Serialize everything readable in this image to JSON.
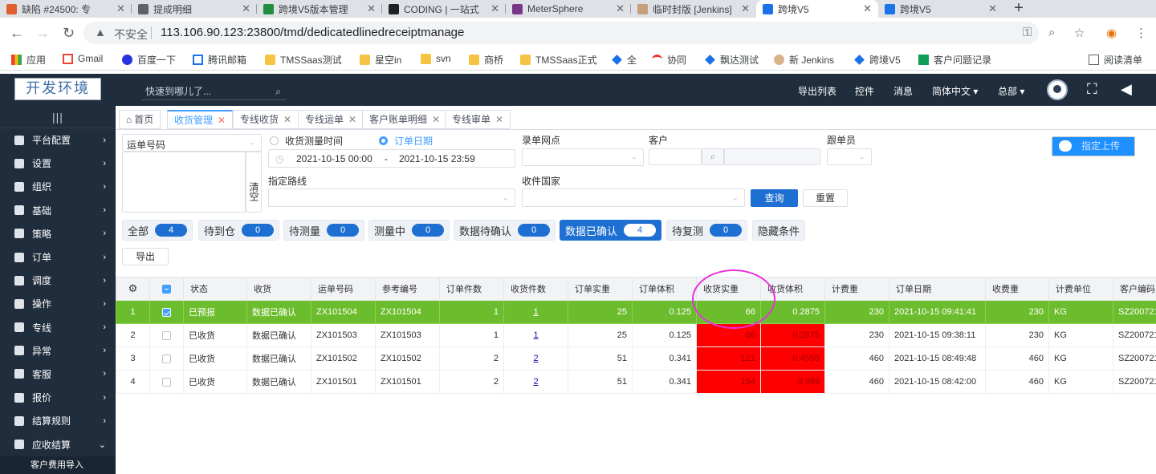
{
  "browser": {
    "tabs": [
      {
        "label": "缺陷 #24500: 专",
        "color": "#e06030"
      },
      {
        "label": "提成明细",
        "color": "#5f6368"
      },
      {
        "label": "跨境V5版本管理",
        "color": "#1e8e3e"
      },
      {
        "label": "CODING | 一站式",
        "color": "#202124"
      },
      {
        "label": "MeterSphere",
        "color": "#783887"
      },
      {
        "label": "临时封版 [Jenkins]",
        "color": "#c5a07a"
      },
      {
        "label": "跨境V5",
        "color": "#1a73e8"
      },
      {
        "label": "跨境V5",
        "color": "#1a73e8"
      }
    ],
    "new_tab": "+",
    "back": "←",
    "forward": "→",
    "reload": "↻",
    "warn_icon": "▲",
    "insecure_label": "不安全",
    "url": "113.106.90.123:23800/tmd/dedicatedlinedreceiptmanage",
    "right_icons": [
      "⚿",
      "⌕",
      "☆",
      "◉",
      "⋮"
    ],
    "bookmarks": [
      {
        "label": "应用",
        "icon": "apps"
      },
      {
        "label": "Gmail",
        "icon": "gmail"
      },
      {
        "label": "百度一下",
        "icon": "baidu"
      },
      {
        "label": "腾讯邮箱",
        "icon": "mail"
      },
      {
        "label": "TMSSaas测试",
        "icon": "folder"
      },
      {
        "label": "星空in",
        "icon": "folder"
      },
      {
        "label": "svn",
        "icon": "folder"
      },
      {
        "label": "商桥",
        "icon": "folder"
      },
      {
        "label": "TMSSaas正式",
        "icon": "folder"
      },
      {
        "label": "全",
        "icon": "app"
      },
      {
        "label": "协同",
        "icon": "app"
      },
      {
        "label": "飘达测试",
        "icon": "app"
      },
      {
        "label": "新 Jenkins",
        "icon": "jenkins"
      },
      {
        "label": "跨境V5",
        "icon": "app"
      },
      {
        "label": "客户问题记录",
        "icon": "sheet"
      }
    ],
    "reading_list": "阅读清单"
  },
  "header": {
    "logo": "开发环境",
    "search_placeholder": "快速到哪儿了...",
    "search_icon": "⌕",
    "links": [
      "导出列表",
      "控件",
      "消息",
      "简体中文 ▾",
      "总部 ▾"
    ],
    "fullscreen_icon": "⛶",
    "collapse_icon": "◀"
  },
  "sidebar": {
    "toggle": "|||",
    "items": [
      {
        "label": "平台配置",
        "chev": "›"
      },
      {
        "label": "设置",
        "chev": "›"
      },
      {
        "label": "组织",
        "chev": "›"
      },
      {
        "label": "基础",
        "chev": "›"
      },
      {
        "label": "策略",
        "chev": "›"
      },
      {
        "label": "订单",
        "chev": "›"
      },
      {
        "label": "调度",
        "chev": "›"
      },
      {
        "label": "操作",
        "chev": "›"
      },
      {
        "label": "专线",
        "chev": "›"
      },
      {
        "label": "异常",
        "chev": "›"
      },
      {
        "label": "客服",
        "chev": "›"
      },
      {
        "label": "报价",
        "chev": "›"
      },
      {
        "label": "结算规则",
        "chev": "›"
      },
      {
        "label": "应收结算",
        "chev": "⌄"
      }
    ],
    "sub_item": "客户费用导入"
  },
  "page_tabs": [
    {
      "label": "首页",
      "close": ""
    },
    {
      "label": "收货管理",
      "close": "✕"
    },
    {
      "label": "专线收货",
      "close": "✕"
    },
    {
      "label": "专线运单",
      "close": "✕"
    },
    {
      "label": "客户账单明细",
      "close": "✕"
    },
    {
      "label": "专线审单",
      "close": "✕"
    }
  ],
  "filters": {
    "waybill_select": "运单号码",
    "clear_label": "清空",
    "radio_measure": "收货测量时间",
    "radio_order": "订单日期",
    "date_start": "2021-10-15 00:00",
    "date_sep": "-",
    "date_end": "2021-10-15 23:59",
    "route_label": "指定路线",
    "branch_label": "录单网点",
    "country_label": "收件国家",
    "customer_label": "客户",
    "follower_label": "跟单员",
    "query_button": "查询",
    "reset_button": "重置",
    "upload_button": "指定上传",
    "arrow": "⌄"
  },
  "chips": [
    {
      "label": "全部",
      "count": "4"
    },
    {
      "label": "待到仓",
      "count": "0"
    },
    {
      "label": "待测量",
      "count": "0"
    },
    {
      "label": "测量中",
      "count": "0"
    },
    {
      "label": "数据待确认",
      "count": "0"
    },
    {
      "label": "数据已确认",
      "count": "4"
    },
    {
      "label": "待复测",
      "count": "0"
    },
    {
      "label": "隐藏条件",
      "count": null
    }
  ],
  "export_button": "导出",
  "table": {
    "gear_icon": "⚙",
    "headers": [
      "状态",
      "收货",
      "运单号码",
      "参考编号",
      "订单件数",
      "收货件数",
      "订单实重",
      "订单体积",
      "收货实重",
      "收货体积",
      "计费重",
      "订单日期",
      "收费重",
      "计费单位",
      "客户编码"
    ],
    "rows": [
      {
        "idx": "1",
        "cells": [
          "已预报",
          "数据已确认",
          "ZX101504",
          "ZX101504",
          "1",
          "1",
          "25",
          "0.125",
          "66",
          "0.2875",
          "230",
          "2021-10-15 09:41:41",
          "230",
          "KG",
          "SZ200721"
        ]
      },
      {
        "idx": "2",
        "cells": [
          "已收货",
          "数据已确认",
          "ZX101503",
          "ZX101503",
          "1",
          "1",
          "25",
          "0.125",
          "66",
          "0.2875",
          "230",
          "2021-10-15 09:38:11",
          "230",
          "KG",
          "SZ200721"
        ]
      },
      {
        "idx": "3",
        "cells": [
          "已收货",
          "数据已确认",
          "ZX101502",
          "ZX101502",
          "2",
          "2",
          "51",
          "0.341",
          "121",
          "0.4559",
          "460",
          "2021-10-15 08:49:48",
          "460",
          "KG",
          "SZ200721"
        ]
      },
      {
        "idx": "4",
        "cells": [
          "已收货",
          "数据已确认",
          "ZX101501",
          "ZX101501",
          "2",
          "2",
          "51",
          "0.341",
          "154",
          "0.969",
          "460",
          "2021-10-15 08:42:00",
          "460",
          "KG",
          "SZ200721"
        ]
      }
    ]
  },
  "colors": {
    "selected_row": "#6cbd2d",
    "alert_cell": "#ff0000",
    "primary": "#1d6fd1",
    "annotation": "#e830e0"
  }
}
